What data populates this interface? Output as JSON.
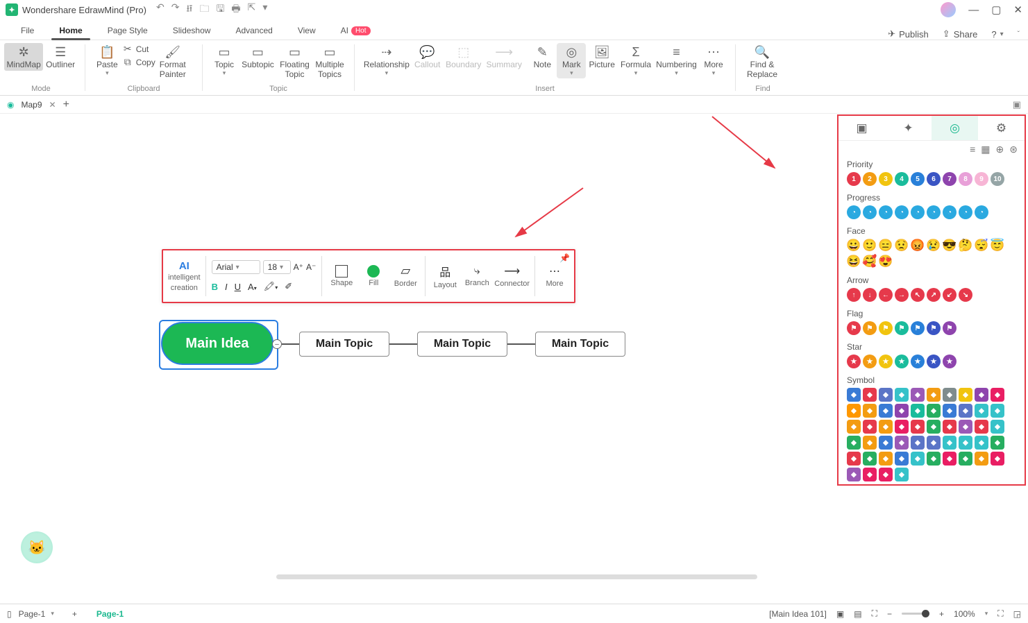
{
  "app": {
    "title": "Wondershare EdrawMind (Pro)"
  },
  "menu": {
    "tabs": [
      "File",
      "Home",
      "Page Style",
      "Slideshow",
      "Advanced",
      "View"
    ],
    "active": "Home",
    "ai_label": "AI",
    "hot": "Hot",
    "publish": "Publish",
    "share": "Share"
  },
  "ribbon": {
    "mode": {
      "label": "Mode",
      "mindmap": "MindMap",
      "outliner": "Outliner"
    },
    "clipboard": {
      "label": "Clipboard",
      "paste": "Paste",
      "cut": "Cut",
      "copy": "Copy",
      "painter1": "Format",
      "painter2": "Painter"
    },
    "topic": {
      "label": "Topic",
      "topic": "Topic",
      "subtopic": "Subtopic",
      "floating1": "Floating",
      "floating2": "Topic",
      "multi1": "Multiple",
      "multi2": "Topics"
    },
    "insert": {
      "label": "Insert",
      "relationship": "Relationship",
      "callout": "Callout",
      "boundary": "Boundary",
      "summary": "Summary",
      "note": "Note",
      "mark": "Mark",
      "picture": "Picture",
      "formula": "Formula",
      "numbering": "Numbering",
      "more": "More"
    },
    "find": {
      "label": "Find",
      "find1": "Find &",
      "find2": "Replace"
    }
  },
  "tab": {
    "name": "Map9"
  },
  "float": {
    "ai1": "intelligent",
    "ai2": "creation",
    "font": "Arial",
    "size": "18",
    "shape": "Shape",
    "fill": "Fill",
    "border": "Border",
    "layout": "Layout",
    "branch": "Branch",
    "connector": "Connector",
    "more": "More"
  },
  "nodes": {
    "main": "Main Idea",
    "t1": "Main Topic",
    "t2": "Main Topic",
    "t3": "Main Topic"
  },
  "panel": {
    "priority": "Priority",
    "progress": "Progress",
    "face": "Face",
    "arrow": "Arrow",
    "flag": "Flag",
    "star": "Star",
    "symbol": "Symbol",
    "priority_colors": [
      "#e6394b",
      "#f39c12",
      "#f1c40f",
      "#1abc9c",
      "#2980d9",
      "#3a55c4",
      "#8e44ad",
      "#e8a0d8",
      "#f7b5d5",
      "#95a5a6"
    ],
    "progress_colors": [
      "#2aa9e0",
      "#2aa9e0",
      "#2aa9e0",
      "#2aa9e0",
      "#2aa9e0",
      "#2aa9e0",
      "#2aa9e0",
      "#2aa9e0",
      "#2aa9e0"
    ],
    "arrow_colors": [
      "#e6394b",
      "#e6394b",
      "#e6394b",
      "#e6394b",
      "#e6394b",
      "#e6394b",
      "#e6394b",
      "#e6394b"
    ],
    "arrow_glyphs": [
      "↑",
      "↓",
      "←",
      "→",
      "↖",
      "↗",
      "↙",
      "↘"
    ],
    "flag_colors": [
      "#e6394b",
      "#f39c12",
      "#f1c40f",
      "#1abc9c",
      "#2980d9",
      "#3a55c4",
      "#8e44ad"
    ],
    "star_colors": [
      "#e6394b",
      "#f39c12",
      "#f1c40f",
      "#1abc9c",
      "#2980d9",
      "#3a55c4",
      "#8e44ad"
    ],
    "symbol_colors": [
      "#3a7bd5",
      "#e6394b",
      "#5b75c7",
      "#36c2c9",
      "#9b59b6",
      "#f39c12",
      "#7f8c8d",
      "#f1c40f",
      "#8e44ad",
      "#e91e63",
      "#ff9800",
      "#f39c12",
      "#3a7bd5",
      "#8e44ad",
      "#1abc9c",
      "#27ae60",
      "#3a7bd5",
      "#5b75c7",
      "#36c2c9",
      "#36c2c9",
      "#f39c12",
      "#e6394b",
      "#f39c12",
      "#e91e63",
      "#e6394b",
      "#27ae60",
      "#e6394b",
      "#9b59b6",
      "#e6394b",
      "#36c2c9",
      "#27ae60",
      "#f39c12",
      "#3a7bd5",
      "#9b59b6",
      "#5b75c7",
      "#5b75c7",
      "#36c2c9",
      "#36c2c9",
      "#36c2c9",
      "#27ae60",
      "#e6394b",
      "#27ae60",
      "#f39c12",
      "#3a7bd5",
      "#36c2c9",
      "#27ae60",
      "#e91e63",
      "#27ae60",
      "#f39c12",
      "#e91e63",
      "#9b59b6",
      "#e91e63",
      "#e91e63",
      "#36c2c9"
    ]
  },
  "status": {
    "page": "Page-1",
    "link": "Page-1",
    "info": "[Main Idea 101]",
    "zoom": "100%"
  }
}
